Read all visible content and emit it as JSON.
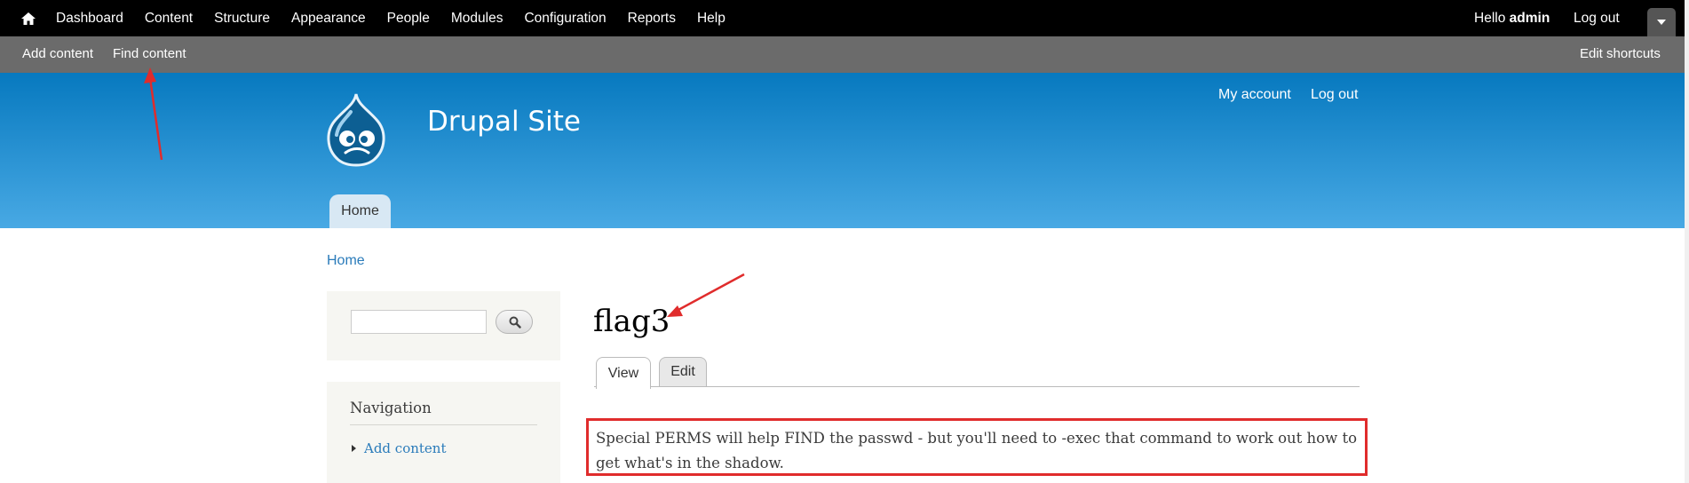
{
  "toolbar": {
    "home_icon": "home-icon",
    "menu": [
      "Dashboard",
      "Content",
      "Structure",
      "Appearance",
      "People",
      "Modules",
      "Configuration",
      "Reports",
      "Help"
    ],
    "hello": "Hello ",
    "username": "admin",
    "logout": "Log out"
  },
  "shortcuts": {
    "add_content": "Add content",
    "find_content": "Find content",
    "edit_shortcuts": "Edit shortcuts"
  },
  "header": {
    "site_name": "Drupal Site",
    "my_account": "My account",
    "logout": "Log out",
    "main_tab": "Home"
  },
  "breadcrumb": "Home",
  "sidebar": {
    "search_value": "",
    "search_icon": "search-icon",
    "navigation_title": "Navigation",
    "navigation_item": "Add content"
  },
  "main": {
    "title": "flag3",
    "tabs": [
      "View",
      "Edit"
    ],
    "body": "Special PERMS will help FIND the passwd - but you'll need to -exec that command to work out how to get what's in the shadow."
  },
  "colors": {
    "toolbar": "#000000",
    "shortcuts_bar": "#6b6b6b",
    "header_top": "#0779bf",
    "header_bottom": "#48a9e4",
    "link": "#2a7bba",
    "annotation": "#e02c2c"
  }
}
